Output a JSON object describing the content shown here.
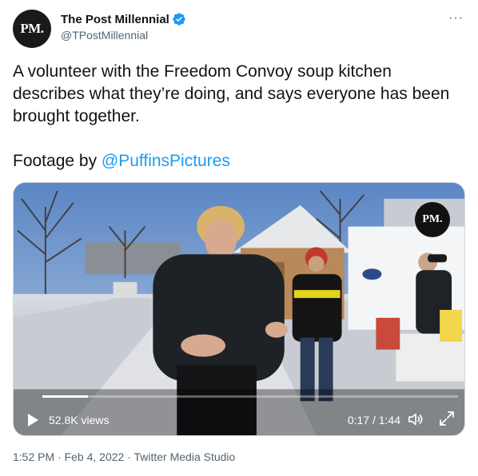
{
  "author": {
    "avatar_text": "PM.",
    "display_name": "The Post Millennial",
    "handle": "@TPostMillennial",
    "verified_color": "#1d9bf0"
  },
  "more_icon": "···",
  "tweet": {
    "text": "A volunteer with the Freedom Convoy soup kitchen describes what they’re doing, and says everyone has been brought together.",
    "footage_prefix": "Footage by ",
    "footage_mention": "@PuffinsPictures"
  },
  "video": {
    "watermark": "PM.",
    "views": "52.8K views",
    "time": "0:17 / 1:44",
    "progress_fraction": 0.11
  },
  "meta": {
    "timestamp": "1:52 PM · Feb 4, 2022 · Twitter Media Studio"
  },
  "colors": {
    "accent": "#1d9bf0",
    "text": "#0f1419",
    "secondary": "#536471"
  },
  "icons": [
    "verified-badge-icon",
    "more-icon",
    "play-icon",
    "volume-icon",
    "fullscreen-icon"
  ]
}
